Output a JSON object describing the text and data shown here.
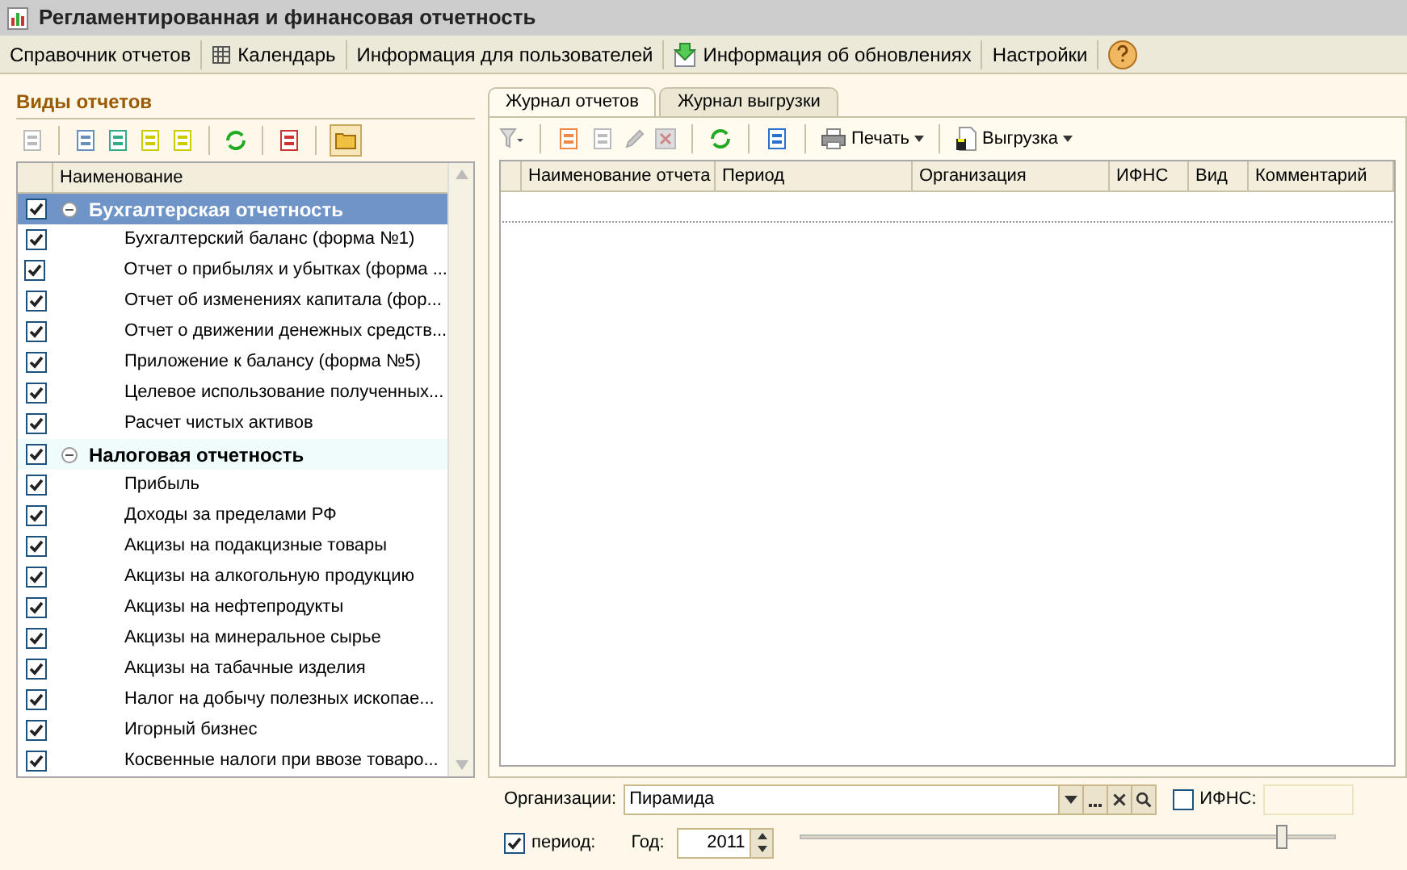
{
  "window": {
    "title": "Регламентированная и финансовая отчетность"
  },
  "menu": [
    "Справочник отчетов",
    "Календарь",
    "Информация для пользователей",
    "Информация об обновлениях",
    "Настройки"
  ],
  "left_panel": {
    "title": "Виды отчетов",
    "column": "Наименование",
    "groups": [
      {
        "label": "Бухгалтерская отчетность",
        "checked": true,
        "expanded": true,
        "selected": true,
        "children": [
          {
            "label": "Бухгалтерский баланс (форма №1)",
            "checked": true
          },
          {
            "label": "Отчет о прибылях и убытках (форма ...",
            "checked": true
          },
          {
            "label": "Отчет об изменениях капитала (фор...",
            "checked": true
          },
          {
            "label": "Отчет о движении денежных средств...",
            "checked": true
          },
          {
            "label": "Приложение к балансу (форма №5)",
            "checked": true
          },
          {
            "label": "Целевое использование полученных...",
            "checked": true
          },
          {
            "label": "Расчет чистых активов",
            "checked": true
          }
        ]
      },
      {
        "label": "Налоговая отчетность",
        "checked": true,
        "expanded": true,
        "selected": false,
        "children": [
          {
            "label": "Прибыль",
            "checked": true
          },
          {
            "label": "Доходы за пределами РФ",
            "checked": true
          },
          {
            "label": "Акцизы на подакцизные товары",
            "checked": true
          },
          {
            "label": "Акцизы на алкогольную продукцию",
            "checked": true
          },
          {
            "label": "Акцизы на нефтепродукты",
            "checked": true
          },
          {
            "label": "Акцизы на минеральное сырье",
            "checked": true
          },
          {
            "label": "Акцизы на табачные изделия",
            "checked": true
          },
          {
            "label": "Налог на добычу полезных ископае...",
            "checked": true
          },
          {
            "label": "Игорный бизнес",
            "checked": true
          },
          {
            "label": "Косвенные налоги при ввозе товаро...",
            "checked": true
          }
        ]
      }
    ]
  },
  "tabs": [
    {
      "label": "Журнал отчетов",
      "selected": true
    },
    {
      "label": "Журнал выгрузки",
      "selected": false
    }
  ],
  "toolbar": {
    "print": "Печать",
    "export": "Выгрузка"
  },
  "table": {
    "columns": [
      "Наименование отчета",
      "Период",
      "Организация",
      "ИФНС",
      "Вид",
      "Комментарий"
    ]
  },
  "filters": {
    "organization_label": "Организации:",
    "organization": "Пирамида",
    "ifns_label": "ИФНС:",
    "ifns_checked": false,
    "period_label": "период:",
    "period_checked": true,
    "year_label": "Год:",
    "year": "2011",
    "level": 0.9
  }
}
